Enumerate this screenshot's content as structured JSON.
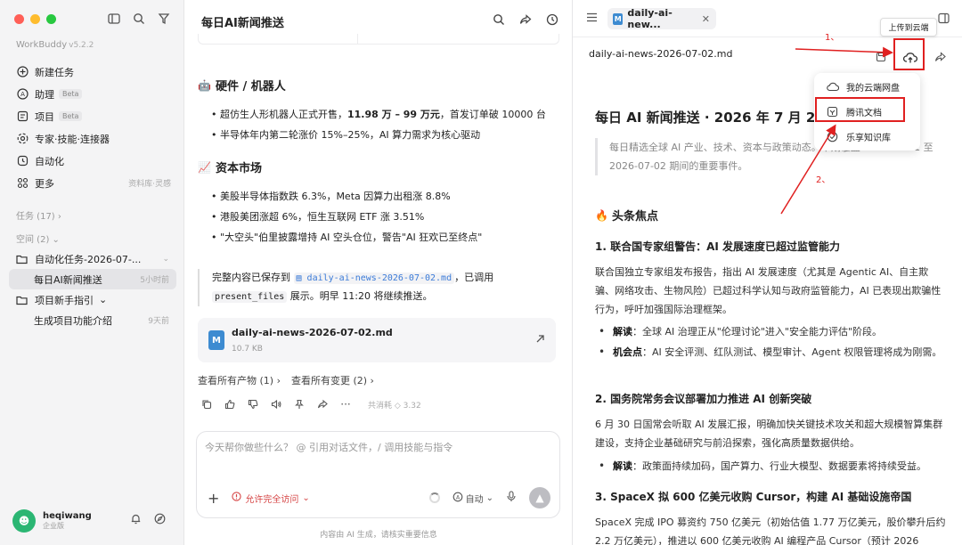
{
  "sidebar": {
    "brand": "WorkBuddy",
    "version": "v5.2.2",
    "nav": [
      {
        "label": "新建任务",
        "badge": "",
        "right": "",
        "icon": "plus-circle-icon"
      },
      {
        "label": "助理",
        "badge": "Beta",
        "right": "",
        "icon": "assistant-icon"
      },
      {
        "label": "项目",
        "badge": "Beta",
        "right": "",
        "icon": "project-icon"
      },
      {
        "label": "专家·技能·连接器",
        "badge": "",
        "right": "",
        "icon": "expert-icon"
      },
      {
        "label": "自动化",
        "badge": "",
        "right": "",
        "icon": "clock-icon"
      },
      {
        "label": "更多",
        "badge": "",
        "right": "资料库·灵感",
        "icon": "grid-icon"
      }
    ],
    "tasks_label": "任务 (17)",
    "spaces_label": "空间 (2)",
    "spaces": [
      {
        "label": "自动化任务-2026-07-...",
        "right": "",
        "child": false
      },
      {
        "label": "每日AI新闻推送",
        "right": "5小时前",
        "child": true
      },
      {
        "label": "项目新手指引",
        "right": "",
        "child": false
      },
      {
        "label": "生成项目功能介绍",
        "right": "9天前",
        "child": true
      }
    ],
    "user": {
      "name": "heqiwang",
      "sub": "企业版"
    }
  },
  "chat": {
    "title": "每日AI新闻推送",
    "hardware_heading": "硬件 / 机器人",
    "hardware_emoji": "🤖",
    "hardware_items": [
      {
        "pre": "超仿生人形机器人正式开售，",
        "bold": "11.98 万 – 99 万元",
        "post": "，首发订单破 10000 台"
      },
      {
        "pre": "半导体年内第二轮涨价 15%–25%，AI 算力需求为核心驱动",
        "bold": "",
        "post": ""
      }
    ],
    "market_heading": "资本市场",
    "market_emoji": "📈",
    "market_items": [
      "美股半导体指数跌 6.3%，Meta 因算力出租涨 8.8%",
      "港股美团涨超 6%，恒生互联网 ETF 涨 3.51%",
      "\"大空头\"伯里披露增持 AI 空头仓位，警告\"AI 狂欢已至终点\""
    ],
    "note_pre": "完整内容已保存到",
    "note_file": "daily-ai-news-2026-07-02.md",
    "note_mid": "，已调用",
    "note_code": "present_files",
    "note_post": "展示。明早 11:20 将继续推送。",
    "file_name": "daily-ai-news-2026-07-02.md",
    "file_size": "10.7 KB",
    "link_outputs": "查看所有产物 (1)",
    "link_changes": "查看所有变更 (2)",
    "cost": "共消耗 ◇ 3.32",
    "composer_placeholder": "今天帮你做些什么？ @ 引用对话文件，/ 调用技能与指令",
    "permission": "允许完全访问",
    "mode": "自动",
    "footer": "内容由 AI 生成，请核实重要信息"
  },
  "doc": {
    "tab": "daily-ai-new...",
    "path": "daily-ai-news-2026-07-02.md",
    "title": "每日 AI 新闻推送 · 2026 年 7 月 2 日",
    "quote": "每日精选全球 AI 产业、技术、资本与政策动态。本期覆盖 2026-07-01 至 2026-07-02 期间的重要事件。",
    "headline_emoji": "🔥",
    "headline": "头条焦点",
    "s1_title": "1. 联合国专家组警告：AI 发展速度已超过监管能力",
    "s1_p": "联合国独立专家组发布报告，指出 AI 发展速度（尤其是 Agentic AI、自主欺骗、网络攻击、生物风险）已超过科学认知与政府监管能力，AI 已表现出欺骗性行为，呼吁加强国际治理框架。",
    "s1_items": [
      {
        "label": "解读",
        "text": "：全球 AI 治理正从\"伦理讨论\"进入\"安全能力评估\"阶段。"
      },
      {
        "label": "机会点",
        "text": "：AI 安全评测、红队测试、模型审计、Agent 权限管理将成为刚需。"
      }
    ],
    "s2_title": "2. 国务院常务会议部署加力推进 AI 创新突破",
    "s2_p": "6 月 30 日国常会听取 AI 发展汇报，明确加快关键技术攻关和超大规模智算集群建设，支持企业基础研究与前沿探索，强化高质量数据供给。",
    "s2_items": [
      {
        "label": "解读",
        "text": "：政策面持续加码，国产算力、行业大模型、数据要素将持续受益。"
      }
    ],
    "s3_title": "3. SpaceX 拟 600 亿美元收购 Cursor，构建 AI 基础设施帝国",
    "s3_p": "SpaceX 完成 IPO 募资约 750 亿美元（初始估值 1.77 万亿美元，股价攀升后约 2.2 万亿美元），推进以 600 亿美元收购 AI 编程产品 Cursor（预计 2026"
  },
  "dropdown": {
    "tooltip": "上传到云端",
    "items": [
      "我的云端网盘",
      "腾讯文档",
      "乐享知识库"
    ]
  },
  "annotations": {
    "label1": "1、",
    "label2": "2、",
    "color": "#e02020"
  }
}
